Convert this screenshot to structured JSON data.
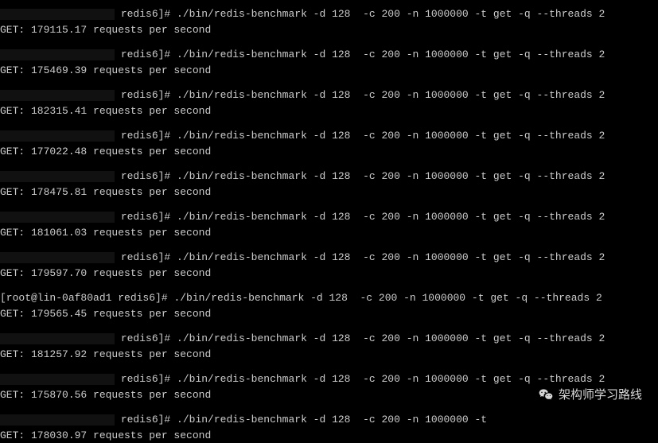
{
  "command": "./bin/redis-benchmark -d 128  -c 200 -n 1000000 -t get -q --threads 2",
  "command_cut": "./bin/redis-benchmark -d 128  -c 200 -n 1000000 -t",
  "prompt_dir": "redis6]#",
  "prompt_full": "[root@lin-0af80ad1 redis6]#",
  "result_suffix": "requests per second",
  "runs": [
    {
      "value": "179115.17",
      "redacted": true
    },
    {
      "value": "175469.39",
      "redacted": true
    },
    {
      "value": "182315.41",
      "redacted": true
    },
    {
      "value": "177022.48",
      "redacted": true
    },
    {
      "value": "178475.81",
      "redacted": true
    },
    {
      "value": "181061.03",
      "redacted": true
    },
    {
      "value": "179597.70",
      "redacted": true
    },
    {
      "value": "179565.45",
      "redacted": false
    },
    {
      "value": "181257.92",
      "redacted": true
    },
    {
      "value": "175870.56",
      "redacted": true
    },
    {
      "value": "178030.97",
      "redacted": true,
      "cut": true
    }
  ],
  "overlay_text": "架构师学习路线"
}
